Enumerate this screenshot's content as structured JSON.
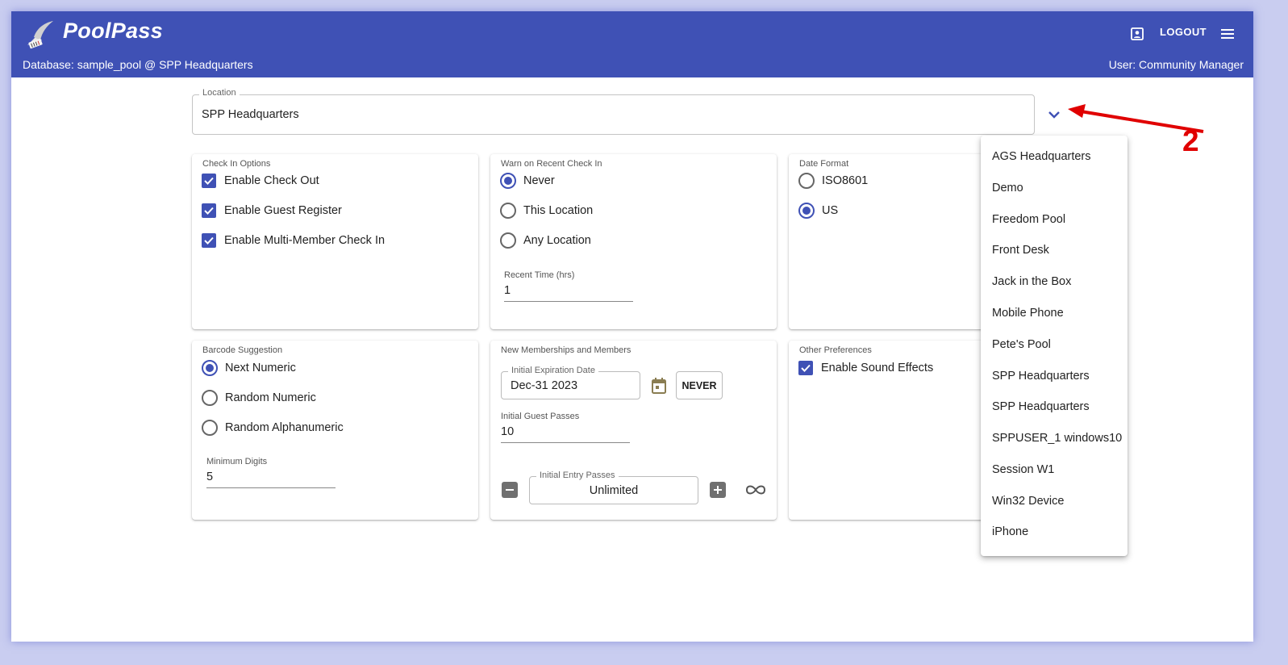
{
  "header": {
    "app_name": "PoolPass",
    "database_line": "Database: sample_pool @ SPP Headquarters",
    "user_line": "User: Community Manager",
    "logout_label": "LOGOUT",
    "brand_color": "#3f51b5"
  },
  "location": {
    "label": "Location",
    "value": "SPP Headquarters"
  },
  "annotation": {
    "number": "2",
    "color": "#e00000"
  },
  "check_in_options": {
    "title": "Check In Options",
    "items": [
      {
        "label": "Enable Check Out",
        "checked": true
      },
      {
        "label": "Enable Guest Register",
        "checked": true
      },
      {
        "label": "Enable Multi-Member Check In",
        "checked": true
      }
    ]
  },
  "warn_recent": {
    "title": "Warn on Recent Check In",
    "options": [
      {
        "label": "Never",
        "selected": true
      },
      {
        "label": "This Location",
        "selected": false
      },
      {
        "label": "Any Location",
        "selected": false
      }
    ],
    "recent_time_label": "Recent Time (hrs)",
    "recent_time_value": "1"
  },
  "date_format": {
    "title": "Date Format",
    "options": [
      {
        "label": "ISO8601",
        "selected": false
      },
      {
        "label": "US",
        "selected": true
      }
    ]
  },
  "barcode": {
    "title": "Barcode Suggestion",
    "options": [
      {
        "label": "Next Numeric",
        "selected": true
      },
      {
        "label": "Random Numeric",
        "selected": false
      },
      {
        "label": "Random Alphanumeric",
        "selected": false
      }
    ],
    "min_digits_label": "Minimum Digits",
    "min_digits_value": "5"
  },
  "new_memberships": {
    "title": "New Memberships and Members",
    "expiration_label": "Initial Expiration Date",
    "expiration_value": "Dec-31 2023",
    "never_label": "NEVER",
    "guest_passes_label": "Initial Guest Passes",
    "guest_passes_value": "10",
    "entry_passes_label": "Initial Entry Passes",
    "entry_passes_value": "Unlimited"
  },
  "other_prefs": {
    "title": "Other Preferences",
    "items": [
      {
        "label": "Enable Sound Effects",
        "checked": true
      }
    ]
  },
  "location_dropdown": {
    "items": [
      "AGS Headquarters",
      "Demo",
      "Freedom Pool",
      "Front Desk",
      "Jack in the Box",
      "Mobile Phone",
      "Pete's Pool",
      "SPP Headquarters",
      "SPP Headquarters",
      "SPPUSER_1 windows10",
      "Session W1",
      "Win32 Device",
      "iPhone"
    ]
  }
}
